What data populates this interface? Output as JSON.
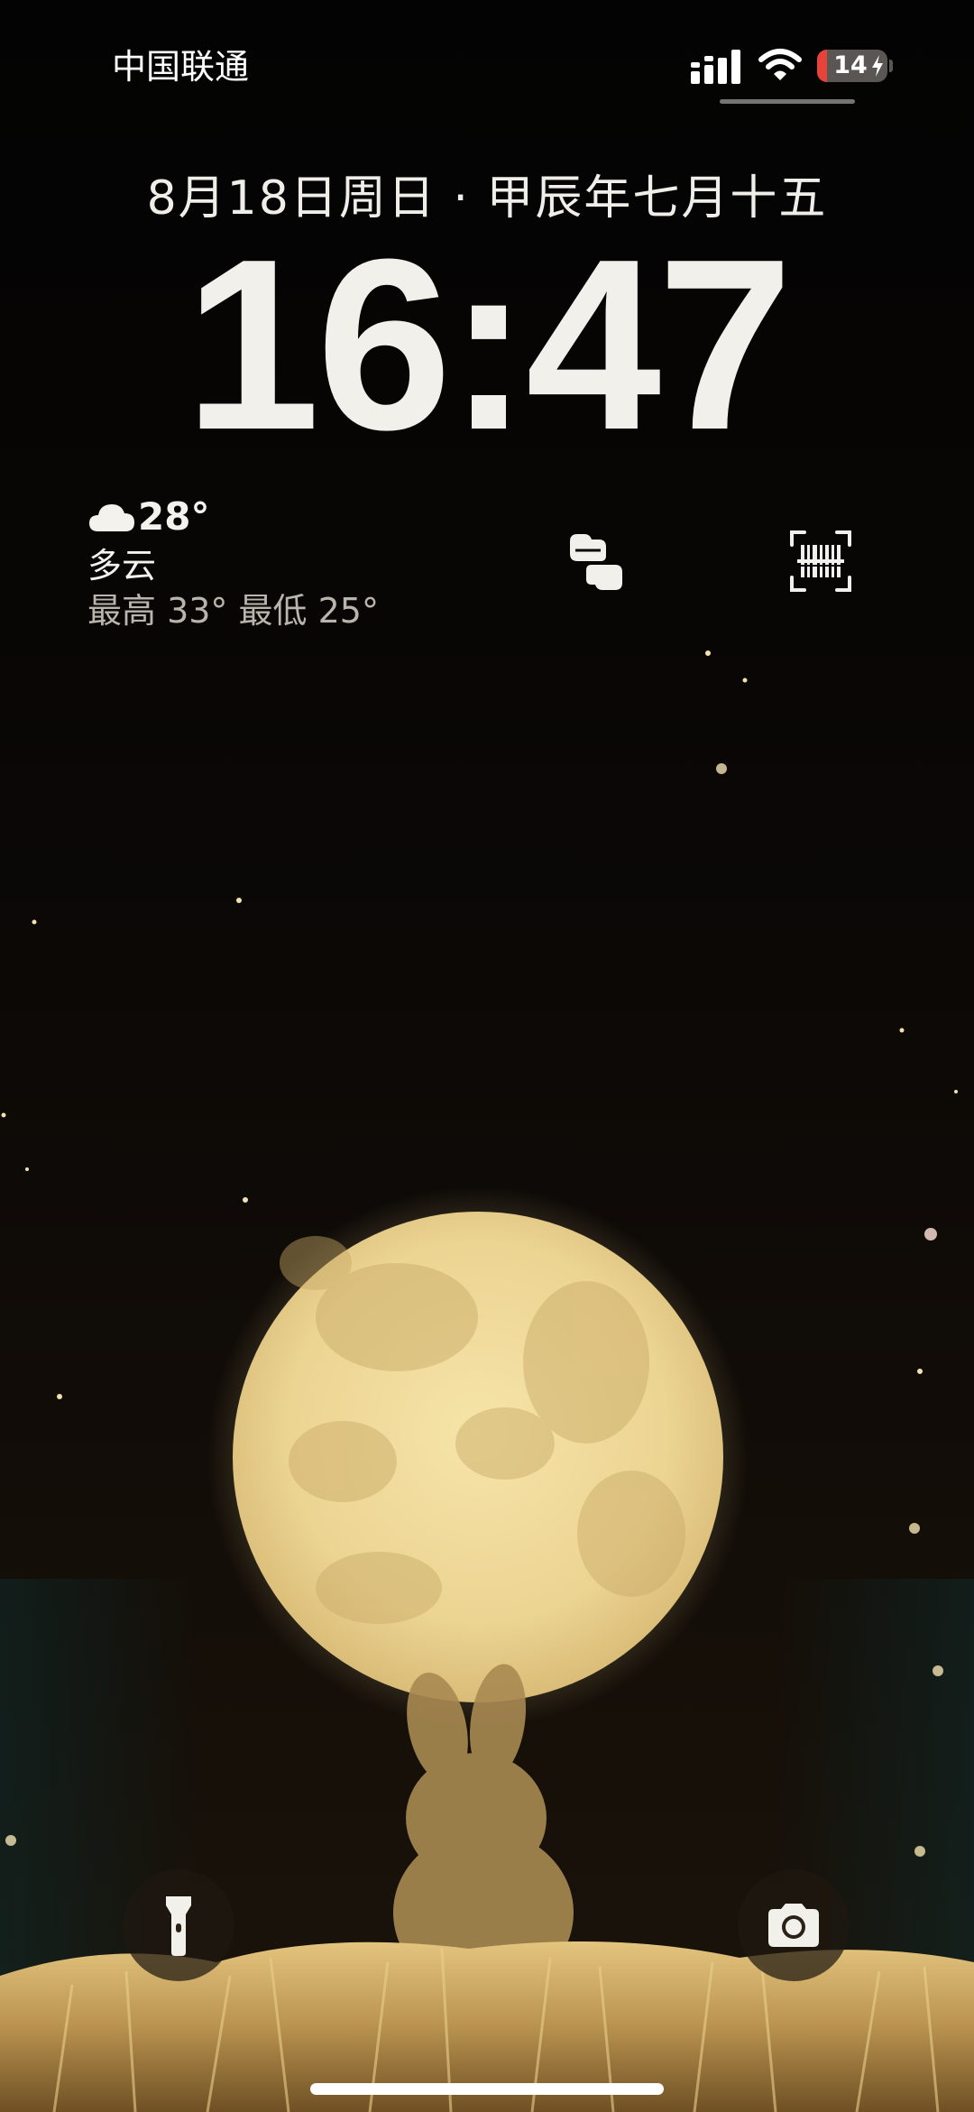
{
  "status_bar": {
    "carrier": "中国联通",
    "battery_level": "14",
    "battery_charging": true,
    "signal_icon": "signal-icon",
    "wifi_icon": "wifi-icon"
  },
  "lock_screen": {
    "date": "8月18日周日 · 甲辰年七月十五",
    "time": "16:47"
  },
  "weather": {
    "icon": "cloud-icon",
    "temperature": "28°",
    "condition": "多云",
    "range": "最高 33° 最低 25°"
  },
  "widgets": {
    "transfer_icon": "transfer-icon",
    "scan_icon": "barcode-scan-icon"
  },
  "quick_actions": {
    "left_icon": "flashlight-icon",
    "right_icon": "camera-icon"
  },
  "colors": {
    "sky": "#070504",
    "moon": "#eed997",
    "moon_shade": "#c9ad6a",
    "grass": "#cfa95f",
    "battery_low": "#e8433a"
  }
}
